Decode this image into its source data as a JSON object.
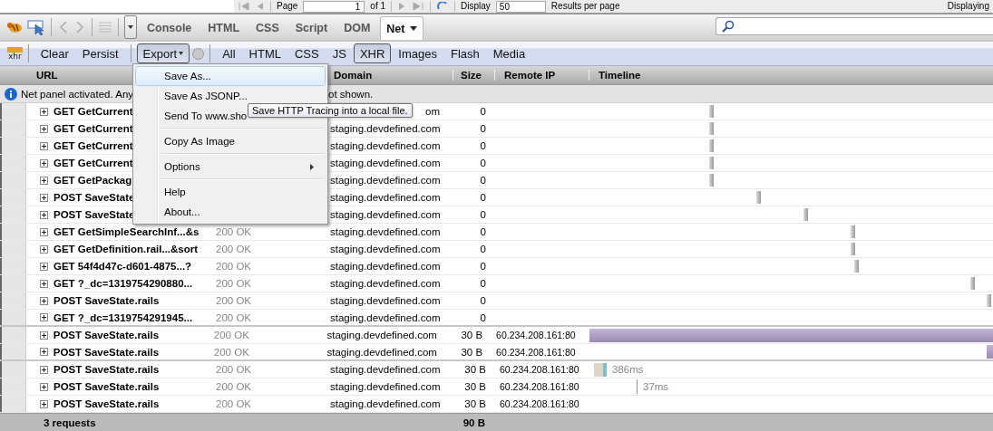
{
  "pager": {
    "page_label": "Page",
    "page_value": "1",
    "of": "of 1",
    "display_label": "Display",
    "display_value": "50",
    "per_page": "Results per page",
    "displaying": "Displaying"
  },
  "tabs": [
    {
      "label": "Console",
      "selected": false
    },
    {
      "label": "HTML",
      "selected": false
    },
    {
      "label": "CSS",
      "selected": false
    },
    {
      "label": "Script",
      "selected": false
    },
    {
      "label": "DOM",
      "selected": false
    },
    {
      "label": "Net",
      "selected": true
    }
  ],
  "filter_bar": {
    "icon_text": "xhr",
    "actions": [
      "Clear",
      "Persist"
    ],
    "export": {
      "label": "Export",
      "pressed": true
    },
    "filters": [
      {
        "label": "All",
        "selected": false
      },
      {
        "label": "HTML",
        "selected": false
      },
      {
        "label": "CSS",
        "selected": false
      },
      {
        "label": "JS",
        "selected": false
      },
      {
        "label": "XHR",
        "selected": true
      },
      {
        "label": "Images",
        "selected": false
      },
      {
        "label": "Flash",
        "selected": false
      },
      {
        "label": "Media",
        "selected": false
      }
    ]
  },
  "columns": {
    "url": "URL",
    "domain": "Domain",
    "size": "Size",
    "remote_ip": "Remote IP",
    "timeline": "Timeline"
  },
  "notice": {
    "text_left": "Net panel activated. Any",
    "text_right": "ot shown."
  },
  "rows": [
    {
      "url": "GET GetCurrent",
      "domain": "om",
      "size": "0",
      "group_end": false
    },
    {
      "url": "GET GetCurrent",
      "domain": "staging.devdefined.com",
      "size": "0",
      "group_end": false
    },
    {
      "url": "GET GetCurrent",
      "domain": "staging.devdefined.com",
      "size": "0",
      "group_end": false
    },
    {
      "url": "GET GetCurrent",
      "domain": "staging.devdefined.com",
      "size": "0",
      "group_end": false
    },
    {
      "url": "GET GetPackag",
      "domain": "staging.devdefined.com",
      "size": "0",
      "group_end": false
    },
    {
      "url": "POST SaveState",
      "domain": "staging.devdefined.com",
      "size": "0",
      "group_end": false
    },
    {
      "url": "POST SaveState",
      "domain": "staging.devdefined.com",
      "size": "0",
      "group_end": false
    },
    {
      "url": "GET GetSimpleSearchInf...&s",
      "status": "200 OK",
      "domain": "staging.devdefined.com",
      "size": "0",
      "group_end": false
    },
    {
      "url": "GET GetDefinition.rail...&sort",
      "status": "200 OK",
      "domain": "staging.devdefined.com",
      "size": "0",
      "group_end": false
    },
    {
      "url": "GET 54f4d47c-d601-4875...?",
      "status": "200 OK",
      "domain": "staging.devdefined.com",
      "size": "0",
      "group_end": false
    },
    {
      "url": "GET ?_dc=1319754290880...",
      "status": "200 OK",
      "domain": "staging.devdefined.com",
      "size": "0",
      "group_end": false
    },
    {
      "url": "POST SaveState.rails",
      "status": "200 OK",
      "domain": "staging.devdefined.com",
      "size": "0",
      "group_end": false
    },
    {
      "url": "GET ?_dc=1319754291945...",
      "status": "200 OK",
      "domain": "staging.devdefined.com",
      "size": "0",
      "group_end": true
    },
    {
      "url": "POST SaveState.rails",
      "status": "200 OK",
      "domain": "staging.devdefined.com",
      "size": "30 B",
      "remote_ip": "60.234.208.161:80",
      "group_end": false
    },
    {
      "url": "POST SaveState.rails",
      "status": "200 OK",
      "domain": "staging.devdefined.com",
      "size": "30 B",
      "remote_ip": "60.234.208.161:80",
      "group_end": true
    },
    {
      "url": "POST SaveState.rails",
      "status": "200 OK",
      "domain": "staging.devdefined.com",
      "size": "30 B",
      "remote_ip": "60.234.208.161:80",
      "timing": "386ms",
      "group_end": false
    },
    {
      "url": "POST SaveState.rails",
      "status": "200 OK",
      "domain": "staging.devdefined.com",
      "size": "30 B",
      "remote_ip": "60.234.208.161:80",
      "timing": "37ms",
      "group_end": false
    },
    {
      "url": "POST SaveState.rails",
      "status": "200 OK",
      "domain": "staging.devdefined.com",
      "size": "30 B",
      "remote_ip": "60.234.208.161:80",
      "group_end": false
    }
  ],
  "footer": {
    "count": "3 requests",
    "total": "90 B"
  },
  "menu": {
    "items": [
      {
        "kind": "item",
        "label": "Save As...",
        "selected": true
      },
      {
        "kind": "item",
        "label": "Save As JSONP...",
        "selected": false
      },
      {
        "kind": "item",
        "label": "Send To www.sho",
        "selected": false
      },
      {
        "kind": "separator"
      },
      {
        "kind": "item",
        "label": "Copy As Image",
        "selected": false
      },
      {
        "kind": "separator"
      },
      {
        "kind": "submenu",
        "label": "Options",
        "selected": false
      },
      {
        "kind": "separator"
      },
      {
        "kind": "item",
        "label": "Help",
        "selected": false
      },
      {
        "kind": "item",
        "label": "About...",
        "selected": false
      }
    ]
  },
  "tooltip": {
    "text": "Save HTTP Tracing into a local file."
  }
}
